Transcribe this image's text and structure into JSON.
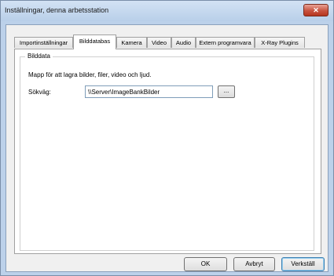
{
  "window": {
    "title": "Inställningar, denna arbetsstation",
    "close_glyph": "✕"
  },
  "tabs": [
    {
      "label": "Importinställningar"
    },
    {
      "label": "Bilddatabas",
      "active": true
    },
    {
      "label": "Kamera"
    },
    {
      "label": "Video"
    },
    {
      "label": "Audio"
    },
    {
      "label": "Extern programvara"
    },
    {
      "label": "X-Ray Plugins"
    }
  ],
  "group": {
    "label": "Bilddata",
    "description": "Mapp för att lagra bilder, filer, video och ljud.",
    "path_label": "Sökväg:",
    "path_value": "\\\\Server\\ImageBankBilder",
    "browse_label": "..."
  },
  "buttons": {
    "ok": "OK",
    "cancel": "Avbryt",
    "apply": "Verkställ"
  }
}
